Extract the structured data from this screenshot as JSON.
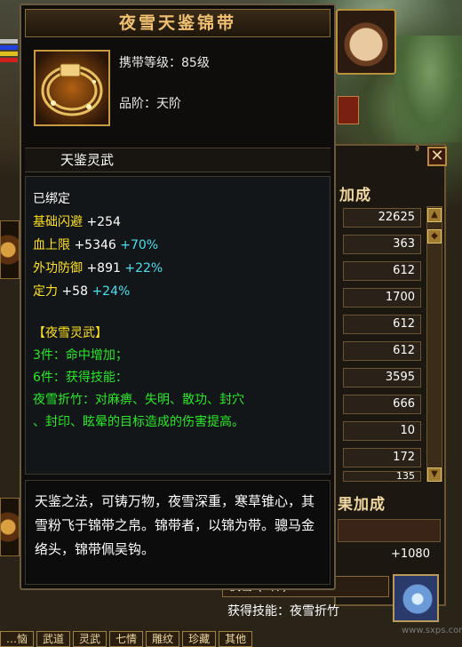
{
  "tooltip": {
    "title": "夜雪天鉴锦带",
    "icon": "golden-belt-icon",
    "carry_level": "携带等级：85级",
    "grade": "品阶：天阶",
    "header": "天鉴灵武",
    "bound": "已绑定",
    "stats": [
      {
        "name": "基础闪避",
        "flat": "+254",
        "pct": ""
      },
      {
        "name": "血上限",
        "flat": "+5346",
        "pct": "+70%"
      },
      {
        "name": "外功防御",
        "flat": "+891",
        "pct": "+22%"
      },
      {
        "name": "定力",
        "flat": "+58",
        "pct": "+24%"
      }
    ],
    "set_name": "【夜雪灵武】",
    "set_lines": [
      "3件：命中增加；",
      "6件：获得技能：",
      "夜雪折竹：对麻痹、失明、散功、封穴",
      "、封印、眩晕的目标造成的伤害提高。"
    ],
    "description": "天鉴之法，可铸万物，夜雪深重，寒草锥心，其雪粉飞于锦带之帛。锦带者，以锦为带。骢马金络头，锦带佩吴钩。"
  },
  "right_panel": {
    "title": "加成",
    "values": [
      "22625",
      "363",
      "612",
      "1700",
      "612",
      "612",
      "3595",
      "666",
      "10",
      "172",
      "135"
    ],
    "title2": "果加成",
    "total": "+1080",
    "set_label": "夜雪 (6件)：",
    "set_skill": "获得技能：夜雪折竹",
    "skill_icon": "ice-skill-icon",
    "close_icon": "close-icon",
    "corner_glyph": "ª"
  },
  "bottom_tabs": [
    "…恼",
    "武道",
    "灵武",
    "七情",
    "雕纹",
    "珍藏",
    "其他"
  ],
  "watermark": "www.sxps.com",
  "colors": {
    "set_green": "#28e828",
    "pct_cyan": "#48e0f0",
    "title_gold": "#f0c070"
  }
}
